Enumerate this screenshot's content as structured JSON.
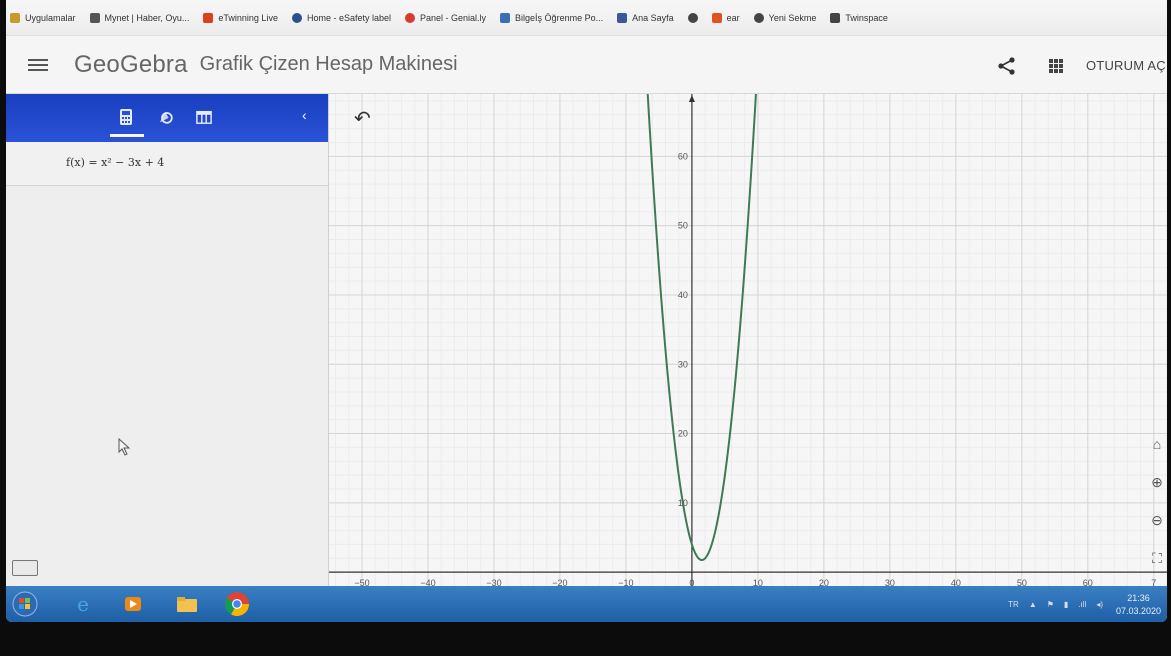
{
  "bookmarks": [
    {
      "label": "Uygulamalar",
      "icon": "apps-icon",
      "color": "#c79a2e"
    },
    {
      "label": "Mynet | Haber, Oyu...",
      "icon": "mynet-icon",
      "color": "#555555"
    },
    {
      "label": "eTwinning Live",
      "icon": "etwinning-icon",
      "color": "#d9421a"
    },
    {
      "label": "Home - eSafety label",
      "icon": "esafety-icon",
      "color": "#2a4f8c"
    },
    {
      "label": "Panel - Genial.ly",
      "icon": "genially-icon",
      "color": "#d33c2f"
    },
    {
      "label": "Bilgeİş Öğrenme Po...",
      "icon": "bilgeis-icon",
      "color": "#3b6fb5"
    },
    {
      "label": "Ana Sayfa",
      "icon": "facebook-icon",
      "color": "#3b5998"
    },
    {
      "label": "",
      "icon": "globe-icon",
      "color": "#444444"
    },
    {
      "label": "ear",
      "icon": "ear-icon",
      "color": "#e0531f"
    },
    {
      "label": "Yeni Sekme",
      "icon": "globe-icon",
      "color": "#444444"
    },
    {
      "label": "Twinspace",
      "icon": "twinspace-icon",
      "color": "#444444"
    }
  ],
  "header": {
    "logo": "GeoGebra",
    "title": "Grafik Çizen Hesap Makinesi",
    "signin": "OTURUM AÇ"
  },
  "algebra": {
    "expression": "f(x) = x² − 3x + 4"
  },
  "graph": {
    "function": "x^2 - 3x + 4",
    "x_range": [
      -55,
      72
    ],
    "y_range": [
      -2,
      69
    ],
    "x_ticks": [
      "−50",
      "−40",
      "−30",
      "−20",
      "−10",
      "0",
      "10",
      "20",
      "30",
      "40",
      "50",
      "60",
      "7"
    ],
    "y_ticks": [
      "10",
      "20",
      "30",
      "40",
      "50",
      "60"
    ],
    "curve_color": "#3f7a55"
  },
  "taskbar": {
    "tray": [
      "TR",
      "▲",
      "⚑",
      "▮",
      ".ıll",
      "◂)"
    ],
    "time": "21:36",
    "date": "07.03.2020"
  }
}
